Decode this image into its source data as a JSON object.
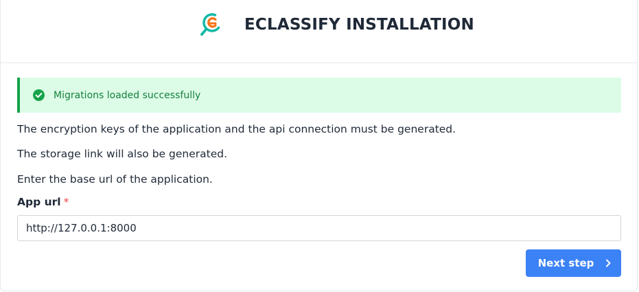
{
  "header": {
    "title": "ECLASSIFY INSTALLATION",
    "logo_icon": "eclassify-logo-icon"
  },
  "alert": {
    "icon": "check-circle-icon",
    "message": "Migrations loaded successfully",
    "color": "#16a34a"
  },
  "body": {
    "line1": "The encryption keys of the application and the api connection must be generated.",
    "line2": "The storage link will also be generated.",
    "line3": "Enter the base url of the application."
  },
  "form": {
    "app_url_label": "App url",
    "required_marker": "*",
    "app_url_value": "http://127.0.0.1:8000"
  },
  "actions": {
    "next_label": "Next step",
    "next_icon": "chevron-right-icon",
    "accent": "#3b82f6"
  }
}
